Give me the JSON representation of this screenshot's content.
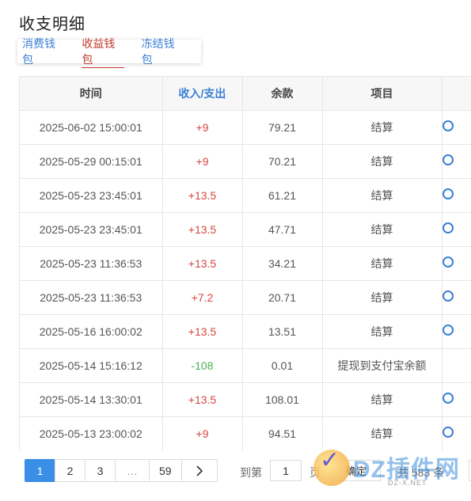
{
  "page": {
    "title": "收支明细"
  },
  "tabs": [
    {
      "label": "消费钱包",
      "active": false
    },
    {
      "label": "收益钱包",
      "active": true
    },
    {
      "label": "冻结钱包",
      "active": false
    }
  ],
  "table": {
    "headers": [
      "时间",
      "收入/支出",
      "余款",
      "项目",
      ""
    ],
    "rows": [
      {
        "time": "2025-06-02 15:00:01",
        "amount": "+9",
        "balance": "79.21",
        "item": "结算"
      },
      {
        "time": "2025-05-29 00:15:01",
        "amount": "+9",
        "balance": "70.21",
        "item": "结算"
      },
      {
        "time": "2025-05-23 23:45:01",
        "amount": "+13.5",
        "balance": "61.21",
        "item": "结算"
      },
      {
        "time": "2025-05-23 23:45:01",
        "amount": "+13.5",
        "balance": "47.71",
        "item": "结算"
      },
      {
        "time": "2025-05-23 11:36:53",
        "amount": "+13.5",
        "balance": "34.21",
        "item": "结算"
      },
      {
        "time": "2025-05-23 11:36:53",
        "amount": "+7.2",
        "balance": "20.71",
        "item": "结算"
      },
      {
        "time": "2025-05-16 16:00:02",
        "amount": "+13.5",
        "balance": "13.51",
        "item": "结算"
      },
      {
        "time": "2025-05-14 15:16:12",
        "amount": "-108",
        "balance": "0.01",
        "item": "提现到支付宝余额"
      },
      {
        "time": "2025-05-14 13:30:01",
        "amount": "+13.5",
        "balance": "108.01",
        "item": "结算"
      },
      {
        "time": "2025-05-13 23:00:02",
        "amount": "+9",
        "balance": "94.51",
        "item": "结算"
      }
    ]
  },
  "pagination": {
    "pages": [
      "1",
      "2",
      "3",
      "…",
      "59"
    ],
    "next_icon": "›",
    "goto_label": "到第",
    "goto_value": "1",
    "page_unit": "页",
    "confirm_label": "确定",
    "total_text": "共 583 条"
  },
  "watermark": {
    "text": "DZ插件网",
    "sub": "DZ-X.NET"
  },
  "colors": {
    "accent": "#3a8ee6",
    "income": "#d64541",
    "expense": "#4caf50",
    "active_tab": "#c0392b"
  }
}
